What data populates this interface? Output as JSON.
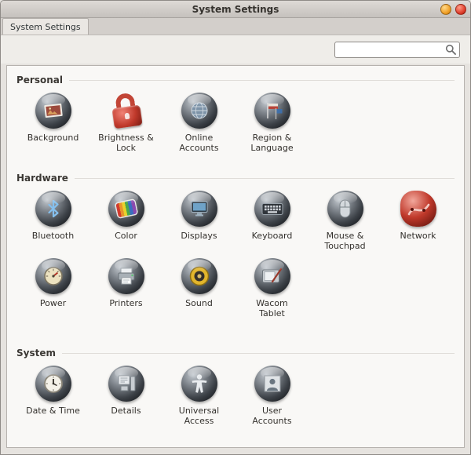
{
  "window": {
    "title": "System Settings"
  },
  "breadcrumb": {
    "label": "System Settings"
  },
  "search": {
    "value": "",
    "placeholder": ""
  },
  "sections": [
    {
      "title": "Personal",
      "items": [
        {
          "label": "Background",
          "icon": "background-icon"
        },
        {
          "label": "Brightness & Lock",
          "icon": "brightness-lock-icon"
        },
        {
          "label": "Online Accounts",
          "icon": "online-accounts-icon"
        },
        {
          "label": "Region & Language",
          "icon": "region-language-icon"
        }
      ]
    },
    {
      "title": "Hardware",
      "items": [
        {
          "label": "Bluetooth",
          "icon": "bluetooth-icon"
        },
        {
          "label": "Color",
          "icon": "color-icon"
        },
        {
          "label": "Displays",
          "icon": "displays-icon"
        },
        {
          "label": "Keyboard",
          "icon": "keyboard-icon"
        },
        {
          "label": "Mouse & Touchpad",
          "icon": "mouse-touchpad-icon"
        },
        {
          "label": "Network",
          "icon": "network-icon"
        },
        {
          "label": "Power",
          "icon": "power-icon"
        },
        {
          "label": "Printers",
          "icon": "printers-icon"
        },
        {
          "label": "Sound",
          "icon": "sound-icon"
        },
        {
          "label": "Wacom Tablet",
          "icon": "wacom-tablet-icon"
        }
      ]
    },
    {
      "title": "System",
      "items": [
        {
          "label": "Date & Time",
          "icon": "date-time-icon"
        },
        {
          "label": "Details",
          "icon": "details-icon"
        },
        {
          "label": "Universal Access",
          "icon": "universal-access-icon"
        },
        {
          "label": "User Accounts",
          "icon": "user-accounts-icon"
        }
      ]
    }
  ]
}
